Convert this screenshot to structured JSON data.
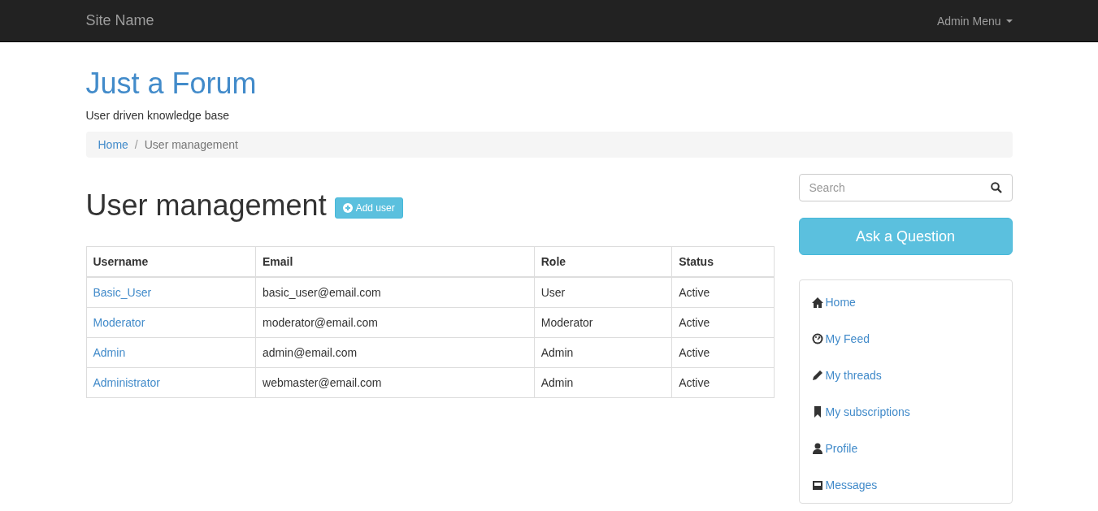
{
  "navbar": {
    "brand": "Site Name",
    "menu": "Admin Menu"
  },
  "header": {
    "title": "Just a Forum",
    "tagline": "User driven knowledge base"
  },
  "breadcrumb": {
    "separator": "/",
    "items": [
      {
        "label": "Home",
        "current": false
      },
      {
        "label": "User management",
        "current": true
      }
    ]
  },
  "page": {
    "title": "User management",
    "add_button": "Add user"
  },
  "table": {
    "columns": [
      "Username",
      "Email",
      "Role",
      "Status"
    ],
    "rows": [
      [
        "Basic_User",
        "basic_user@email.com",
        "User",
        "Active"
      ],
      [
        "Moderator",
        "moderator@email.com",
        "Moderator",
        "Active"
      ],
      [
        "Admin",
        "admin@email.com",
        "Admin",
        "Active"
      ],
      [
        "Administrator",
        "webmaster@email.com",
        "Admin",
        "Active"
      ]
    ]
  },
  "sidebar": {
    "search": {
      "placeholder": "Search"
    },
    "ask_button": "Ask a Question",
    "items": [
      {
        "label": "Home"
      },
      {
        "label": "My Feed"
      },
      {
        "label": "My threads"
      },
      {
        "label": "My subscriptions"
      },
      {
        "label": "Profile"
      },
      {
        "label": "Messages"
      }
    ]
  }
}
